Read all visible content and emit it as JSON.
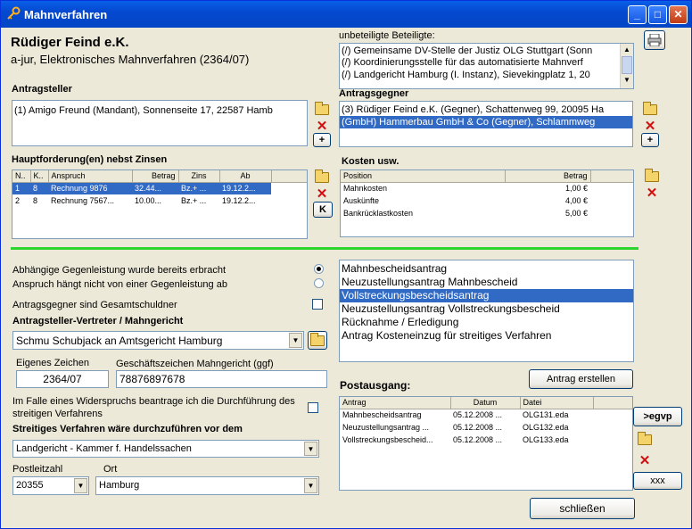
{
  "window": {
    "title": "Mahnverfahren"
  },
  "header": {
    "client_name": "Rüdiger Feind e.K.",
    "case_line": "a-jur, Elektronisches Mahnverfahren (2364/07)"
  },
  "unbeteiligte": {
    "label": "unbeteiligte Beteiligte:",
    "items": [
      "(/)  Gemeinsame DV-Stelle der Justiz OLG Stuttgart (Sonn",
      "(/)  Koordinierungsstelle für das automatisierte Mahnverf",
      "(/)  Landgericht Hamburg (I. Instanz), Sievekingplatz 1, 20"
    ]
  },
  "antragsteller": {
    "label": "Antragsteller",
    "items": [
      "(1)  Amigo Freund (Mandant), Sonnenseite 17, 22587 Hamb"
    ]
  },
  "antragsgegner": {
    "label": "Antragsgegner",
    "items": [
      "(3)  Rüdiger Feind e.K. (Gegner), Schattenweg 99, 20095 Ha",
      "(GmbH)  Hammerbau GmbH & Co  (Gegner), Schlammweg"
    ]
  },
  "hauptforderung": {
    "label": "Hauptforderung(en) nebst Zinsen",
    "columns": [
      "N..",
      "K..",
      "Anspruch",
      "Betrag",
      "Zins",
      "Ab"
    ],
    "rows": [
      [
        "1",
        "8",
        "Rechnung 9876",
        "32.44...",
        "Bz.+ ...",
        "19.12.2..."
      ],
      [
        "2",
        "8",
        "Rechnung 7567...",
        "10.00...",
        "Bz.+ ...",
        "19.12.2..."
      ]
    ],
    "k_button": "K"
  },
  "kosten": {
    "label": "Kosten usw.",
    "columns": [
      "Position",
      "Betrag"
    ],
    "rows": [
      [
        "Mahnkosten",
        "1,00 €"
      ],
      [
        "Auskünfte",
        "4,00 €"
      ],
      [
        "Bankrücklastkosten",
        "5,00 €"
      ]
    ]
  },
  "options": {
    "gegenleistung_erbracht": "Abhängige Gegenleistung wurde bereits erbracht",
    "gegenleistung_unabhaengig": "Anspruch hängt nicht von einer Gegenleistung ab",
    "gesamtschuldner": "Antragsgegner sind Gesamtschuldner"
  },
  "vertreter": {
    "label": "Antragsteller-Vertreter / Mahngericht",
    "value": "Schmu Schubjack an Amtsgericht Hamburg"
  },
  "zeichen": {
    "eigenes_label": "Eigenes Zeichen",
    "eigenes_value": "2364/07",
    "mahngericht_label": "Geschäftszeichen Mahngericht (ggf)",
    "mahngericht_value": "78876897678"
  },
  "widerspruch": {
    "text_line1": "Im Falle eines Widerspruchs beantrage ich die Durchführung des",
    "text_line2": "streitigen Verfahrens"
  },
  "streitig": {
    "label": "Streitiges Verfahren wäre durchzuführen vor dem",
    "value": "Landgericht - Kammer f. Handelssachen",
    "plz_label": "Postleitzahl",
    "plz_value": "20355",
    "ort_label": "Ort",
    "ort_value": "Hamburg"
  },
  "antraege": {
    "items": [
      "Mahnbescheidsantrag",
      "Neuzustellungsantrag Mahnbescheid",
      "Vollstreckungsbescheidsantrag",
      "Neuzustellungsantrag Vollstreckungsbescheid",
      "Rücknahme / Erledigung",
      "Antrag Kosteneinzug für streitiges Verfahren"
    ],
    "selected_index": 2
  },
  "postausgang": {
    "label": "Postausgang:",
    "create_button": "Antrag erstellen",
    "columns": [
      "Antrag",
      "Datum",
      "Datei"
    ],
    "rows": [
      [
        "Mahnbescheidsantrag",
        "05.12.2008 ...",
        "OLG131.eda"
      ],
      [
        "Neuzustellungsantrag ...",
        "05.12.2008 ...",
        "OLG132.eda"
      ],
      [
        "Vollstreckungsbescheid...",
        "05.12.2008 ...",
        "OLG133.eda"
      ]
    ],
    "egvp_button": ">egvp",
    "xxx_button": "xxx"
  },
  "footer": {
    "close_button": "schließen"
  },
  "colors": {
    "separator": "#2fd52f",
    "selection": "#316ac5",
    "title": "#0449d0"
  }
}
